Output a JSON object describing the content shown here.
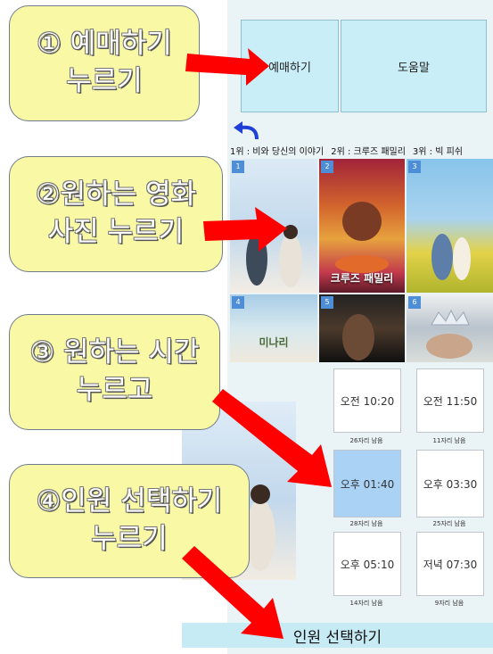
{
  "menu": {
    "booking_label": "예매하기",
    "help_label": "도움말"
  },
  "ranking": {
    "rank1": "1위 : 비와 당신의 이야기",
    "rank2": "2위 : 크루즈 패밀리",
    "rank3": "3위 : 빅 피쉬"
  },
  "posters": [
    {
      "rank": "1",
      "title": ""
    },
    {
      "rank": "2",
      "title": "크루즈 패밀리"
    },
    {
      "rank": "3",
      "title": ""
    },
    {
      "rank": "4",
      "title": "미나리"
    },
    {
      "rank": "5",
      "title": ""
    },
    {
      "rank": "6",
      "title": ""
    }
  ],
  "times": [
    {
      "label": "오전 10:20",
      "seats": "26자리 남음"
    },
    {
      "label": "오전 11:50",
      "seats": "11자리 남음"
    },
    {
      "label": "오후 01:40",
      "seats": "28자리 남음",
      "selected": true
    },
    {
      "label": "오후 03:30",
      "seats": "25자리 남음"
    },
    {
      "label": "오후 05:10",
      "seats": "14자리 남음"
    },
    {
      "label": "저녁 07:30",
      "seats": "9자리 남음"
    }
  ],
  "select_people_label": "인원 선택하기",
  "callouts": [
    {
      "line1": "①  예매하기",
      "line2": "누르기"
    },
    {
      "line1": "②원하는 영화",
      "line2": "사진 누르기"
    },
    {
      "line1": "③ 원하는 시간",
      "line2": "누르고"
    },
    {
      "line1": "④인원 선택하기",
      "line2": "누르기"
    }
  ],
  "colors": {
    "arrow": "#ff0000",
    "callout_bg": "#f9f9a5",
    "button_bg": "#c9eef7",
    "selected_time": "#a9d2f5"
  }
}
